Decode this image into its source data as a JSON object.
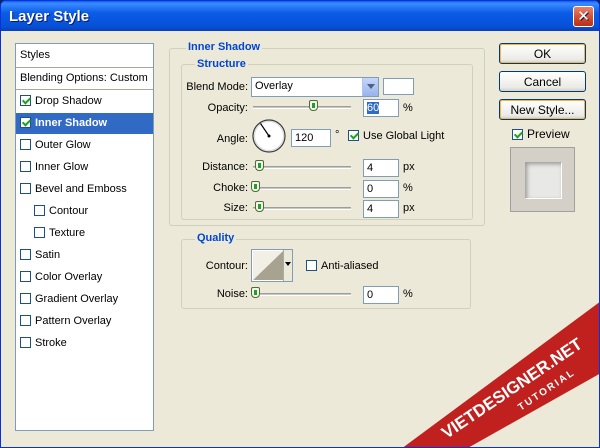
{
  "window": {
    "title": "Layer Style",
    "close_glyph": "✕"
  },
  "styles_panel": {
    "header": "Styles",
    "blending_options": "Blending Options: Custom",
    "items": [
      {
        "label": "Drop Shadow",
        "checked": true
      },
      {
        "label": "Inner Shadow",
        "checked": true,
        "selected": true
      },
      {
        "label": "Outer Glow",
        "checked": false
      },
      {
        "label": "Inner Glow",
        "checked": false
      },
      {
        "label": "Bevel and Emboss",
        "checked": false
      },
      {
        "label": "Contour",
        "checked": false,
        "sub": true
      },
      {
        "label": "Texture",
        "checked": false,
        "sub": true
      },
      {
        "label": "Satin",
        "checked": false
      },
      {
        "label": "Color Overlay",
        "checked": false
      },
      {
        "label": "Gradient Overlay",
        "checked": false
      },
      {
        "label": "Pattern Overlay",
        "checked": false
      },
      {
        "label": "Stroke",
        "checked": false
      }
    ]
  },
  "inner_shadow": {
    "title": "Inner Shadow",
    "structure": {
      "title": "Structure",
      "blend_mode_label": "Blend Mode:",
      "blend_mode_value": "Overlay",
      "color_swatch": "#ffffff",
      "opacity_label": "Opacity:",
      "opacity_value": "60",
      "opacity_unit": "%",
      "angle_label": "Angle:",
      "angle_value": "120",
      "angle_unit": "°",
      "use_global_light_label": "Use Global Light",
      "use_global_light_checked": true,
      "distance_label": "Distance:",
      "distance_value": "4",
      "distance_unit": "px",
      "choke_label": "Choke:",
      "choke_value": "0",
      "choke_unit": "%",
      "size_label": "Size:",
      "size_value": "4",
      "size_unit": "px"
    },
    "quality": {
      "title": "Quality",
      "contour_label": "Contour:",
      "anti_aliased_label": "Anti-aliased",
      "anti_aliased_checked": false,
      "noise_label": "Noise:",
      "noise_value": "0",
      "noise_unit": "%"
    }
  },
  "buttons": {
    "ok": "OK",
    "cancel": "Cancel",
    "new_style": "New Style...",
    "preview_label": "Preview",
    "preview_checked": true
  },
  "watermark": {
    "site": "VIETDESIGNER.NET",
    "sub": "TUTORIAL",
    "color": "#c0201e"
  }
}
